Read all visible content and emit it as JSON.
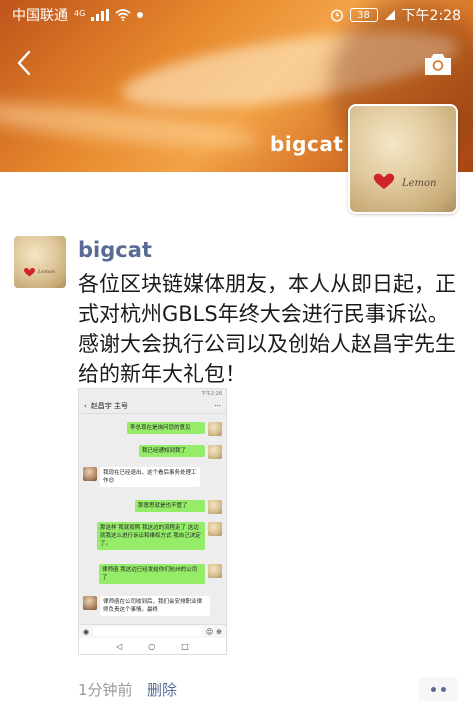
{
  "status_bar": {
    "carrier": "中国联通",
    "network": "4G",
    "battery": "38",
    "time": "下午2:28"
  },
  "cover": {
    "user_name": "bigcat",
    "avatar_text": "Lemon"
  },
  "post": {
    "author": "bigcat",
    "text": "各位区块链媒体朋友，本人从即日起，正式对杭州GBLS年终大会进行民事诉讼。感谢大会执行公司以及创始人赵昌宇先生给的新年大礼包！",
    "time": "1分钟前",
    "delete_label": "删除"
  },
  "embedded_chat": {
    "status_time": "下午2:26",
    "title": "赵昌宇 主号",
    "more": "···",
    "messages": [
      {
        "side": "right",
        "text": "李总现在是询问您的意见"
      },
      {
        "side": "right",
        "text": "我已经通知到我了"
      },
      {
        "side": "left",
        "text": "我现在已经退出，这个看后事务处理工作😊"
      },
      {
        "side": "right",
        "text": "那意思就是也不管了"
      },
      {
        "side": "right",
        "text": "那这样 我就按照 我这边的流程走了 这边就我这么进行诉讼和维权方式 我自己决定了。"
      },
      {
        "side": "right",
        "text": "律师函 我这边已经发给你们杭州的公司了"
      },
      {
        "side": "left",
        "text": "律师函在公司收到后，我们会安排职业律师负责这个事情。最终"
      }
    ],
    "nav": [
      "◁",
      "○",
      "□"
    ]
  },
  "icons": {
    "back": "chevron-left-icon",
    "camera": "camera-icon",
    "more": "more-dots-icon"
  },
  "colors": {
    "link": "#576b95",
    "chat_bubble_self": "#95ec69",
    "cover_orange": "#e7892e"
  }
}
